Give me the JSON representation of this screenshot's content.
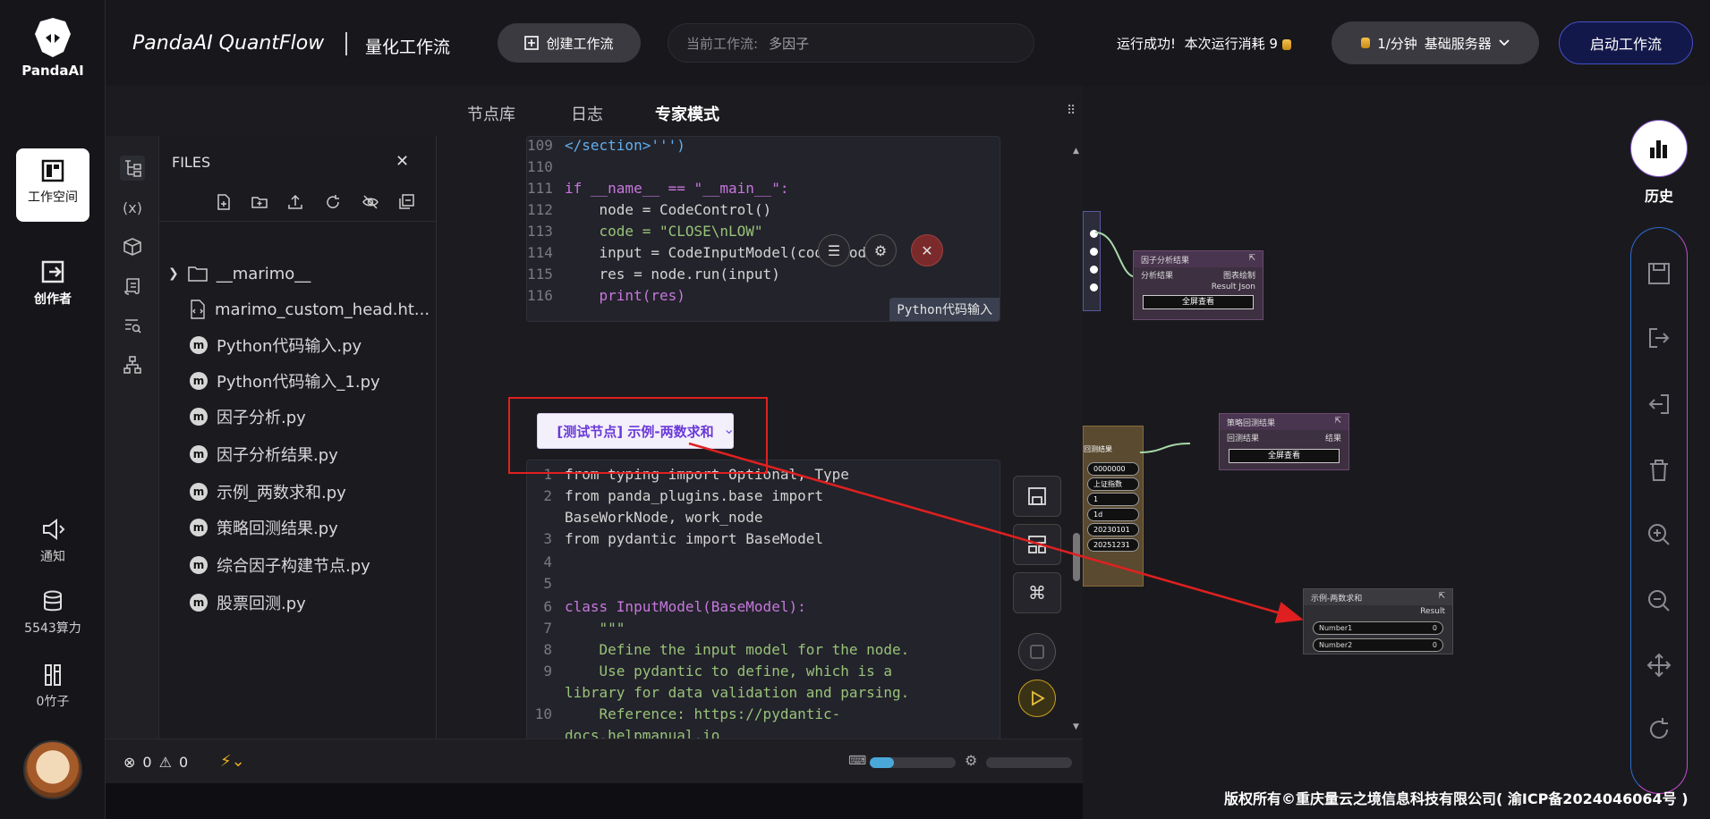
{
  "brand": {
    "logo_text": "PandaAI",
    "title": "PandaAI QuantFlow",
    "subtitle": "量化工作流"
  },
  "header": {
    "create_label": "创建工作流",
    "current_label": "当前工作流:",
    "current_value": "多因子",
    "run_status": "运行成功!",
    "run_cost": "本次运行消耗 9",
    "rate": "1/分钟",
    "server": "基础服务器",
    "start_label": "启动工作流"
  },
  "rail": {
    "workspace": "工作空间",
    "creator": "创作者",
    "notify": "通知",
    "compute": "5543算力",
    "bamboo": "0竹子"
  },
  "tabs": [
    "节点库",
    "日志",
    "专家模式"
  ],
  "files": {
    "title": "FILES",
    "items": [
      "__marimo__",
      "marimo_custom_head.ht...",
      "Python代码输入.py",
      "Python代码输入_1.py",
      "因子分析.py",
      "因子分析结果.py",
      "示例_两数求和.py",
      "策略回测结果.py",
      "综合因子构建节点.py",
      "股票回测.py"
    ]
  },
  "code_top": {
    "lines": [
      {
        "n": "109",
        "t": "</section>''')"
      },
      {
        "n": "110",
        "t": ""
      },
      {
        "n": "111",
        "t": "if __name__ == \"__main__\":"
      },
      {
        "n": "112",
        "t": "    node = CodeControl()"
      },
      {
        "n": "113",
        "t": "    code = \"CLOSE\\nLOW\""
      },
      {
        "n": "114",
        "t": "    input = CodeInputModel(code=code)"
      },
      {
        "n": "115",
        "t": "    res = node.run(input)"
      },
      {
        "n": "116",
        "t": "    print(res)"
      }
    ],
    "lang_tag": "Python代码输入"
  },
  "node_tag": "[测试节点] 示例-两数求和",
  "code_bottom": {
    "lines": [
      {
        "n": "1",
        "t": "from typing import Optional, Type"
      },
      {
        "n": "2",
        "t": "from panda_plugins.base import"
      },
      {
        "n": "",
        "t": "BaseWorkNode, work_node"
      },
      {
        "n": "3",
        "t": "from pydantic import BaseModel"
      },
      {
        "n": "4",
        "t": ""
      },
      {
        "n": "5",
        "t": ""
      },
      {
        "n": "6",
        "t": "class InputModel(BaseModel):"
      },
      {
        "n": "7",
        "t": "    \"\"\""
      },
      {
        "n": "8",
        "t": "    Define the input model for the node."
      },
      {
        "n": "9",
        "t": "    Use pydantic to define, which is a"
      },
      {
        "n": "",
        "t": "library for data validation and parsing."
      },
      {
        "n": "10",
        "t": "    Reference: https://pydantic-"
      },
      {
        "n": "",
        "t": "docs.helpmanual.io"
      }
    ]
  },
  "status": {
    "errors": "0",
    "warnings": "0"
  },
  "canvas": {
    "node1": {
      "title": "因子分析结果",
      "in": "分析结果",
      "out1": "图表绘制",
      "out2": "Result Json",
      "btn": "全屏查看"
    },
    "node2": {
      "title": "策略回测结果",
      "in": "回测结果",
      "out": "结果",
      "btn": "全屏查看"
    },
    "node3": {
      "title": "示例-两数求和",
      "out": "Result",
      "n1": "Number1",
      "v1": "0",
      "n2": "Number2",
      "v2": "0"
    },
    "stub": {
      "r1": "0000000",
      "r2": "上证指数",
      "r3": "1",
      "r4": "1d",
      "r5": "20230101",
      "r6": "20251231",
      "in": "回测结果"
    }
  },
  "right": {
    "history": "历史"
  },
  "copyright": "版权所有©重庆量云之境信息科技有限公司( 渝ICP备2024046064号 )",
  "colors": {
    "accent": "#7a5ae0",
    "annotation": "#e02020",
    "node": "#3d3040"
  }
}
